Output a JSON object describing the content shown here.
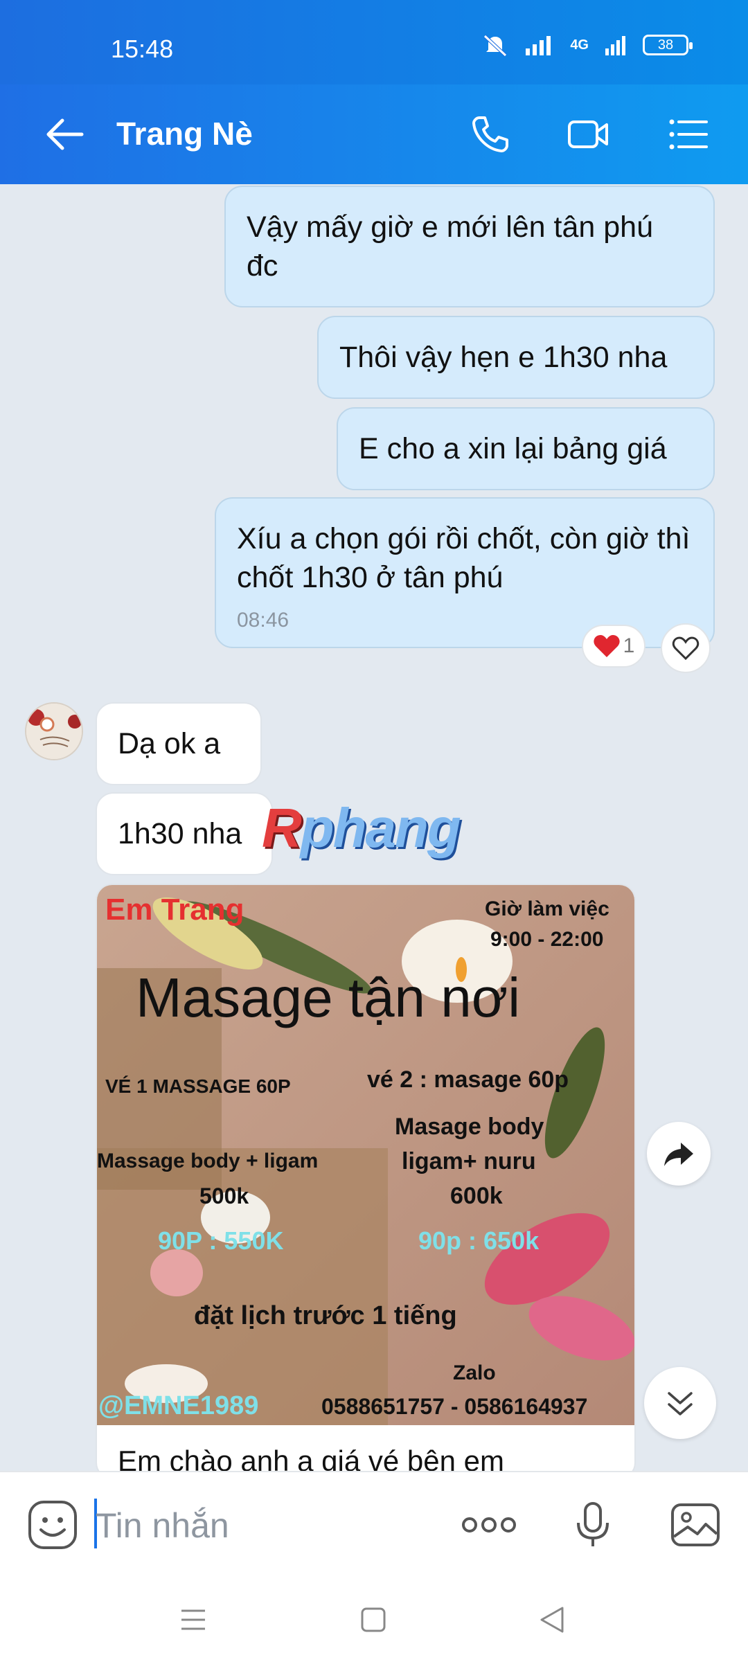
{
  "status": {
    "time": "15:48",
    "network": "4G",
    "battery": "38"
  },
  "header": {
    "contact_name": "Trang Nè"
  },
  "messages": [
    {
      "side": "out",
      "text": "Vậy mấy giờ e mới lên tân phú đc"
    },
    {
      "side": "out",
      "text": "Thôi vậy hẹn e 1h30 nha"
    },
    {
      "side": "out",
      "text": "E cho a xin lại bảng giá"
    },
    {
      "side": "out",
      "text": "Xíu a chọn gói rồi chốt, còn giờ thì chốt 1h30 ở tân phú",
      "time": "08:46",
      "reaction_count": "1"
    },
    {
      "side": "in",
      "text": "Dạ ok a"
    },
    {
      "side": "in",
      "text": "1h30 nha"
    }
  ],
  "watermark": {
    "first": "R",
    "rest": "phang"
  },
  "poster": {
    "name": "Em Trang",
    "hours_label": "Giờ làm việc",
    "hours": "9:00 - 22:00",
    "headline": "Masage tận nơi",
    "ticket1": "VÉ 1 MASSAGE   60P",
    "ticket1_desc": "Massage body + ligam",
    "ticket1_price": "500k",
    "ticket1_90": "90P : 550K",
    "ticket2": "vé 2 : masage  60p",
    "ticket2_desc1": "Masage body",
    "ticket2_desc2": "ligam+ nuru",
    "ticket2_price": "600k",
    "ticket2_90": "90p : 650k",
    "booking": "đặt lịch trước 1 tiếng",
    "zalo_label": "Zalo",
    "handle": "@EMNE1989",
    "phones": "0588651757 - 0586164937"
  },
  "card_caption": "Em chào anh a giá vé bên em",
  "input": {
    "placeholder": "Tin nhắn"
  },
  "colors": {
    "header": "#1f6fe5",
    "out_bubble": "#d5ebfc",
    "in_bubble": "#ffffff",
    "heart": "#e0262f"
  },
  "icons": [
    "back-arrow-icon",
    "phone-icon",
    "video-call-icon",
    "menu-list-icon",
    "heart-icon",
    "share-icon",
    "scroll-down-icon",
    "emoji-icon",
    "more-dots-icon",
    "microphone-icon",
    "gallery-icon"
  ]
}
